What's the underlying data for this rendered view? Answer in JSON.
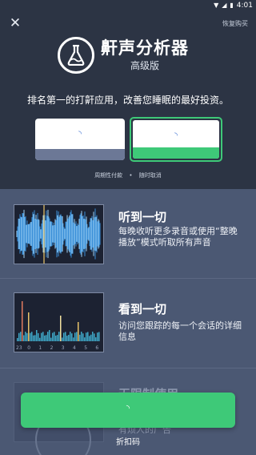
{
  "status_bar": {
    "time": "4:01"
  },
  "header": {
    "close_glyph": "✕",
    "restore_label": "恢复购买",
    "app_name": "鼾声分析器",
    "app_edition": "高级版",
    "tagline": "排名第一的打鼾应用，改善您睡眠的最好投资。"
  },
  "plans": {
    "spinner_glyph": "◝"
  },
  "terms": {
    "left": "周期性付款",
    "dot": "•",
    "right": "随时取消"
  },
  "features": [
    {
      "title": "听到一切",
      "desc": "每晚收听更多录音或使用“整晚播放”模式听取所有声音"
    },
    {
      "title": "看到一切",
      "desc": "访问您跟踪的每一个会话的详细信息"
    },
    {
      "title": "无限制使用",
      "desc": "有烦人的广告"
    }
  ],
  "chart_axis": [
    "23",
    "0",
    "1",
    "2",
    "3",
    "4",
    "5",
    "6"
  ],
  "cta": {
    "spinner_glyph": "◝"
  },
  "discount_label": "折扣码",
  "colors": {
    "accent": "#3ec978",
    "background": "#2c3444",
    "panel": "#4b5873"
  },
  "icons": {
    "logo": "flask-icon",
    "close": "close-icon"
  }
}
